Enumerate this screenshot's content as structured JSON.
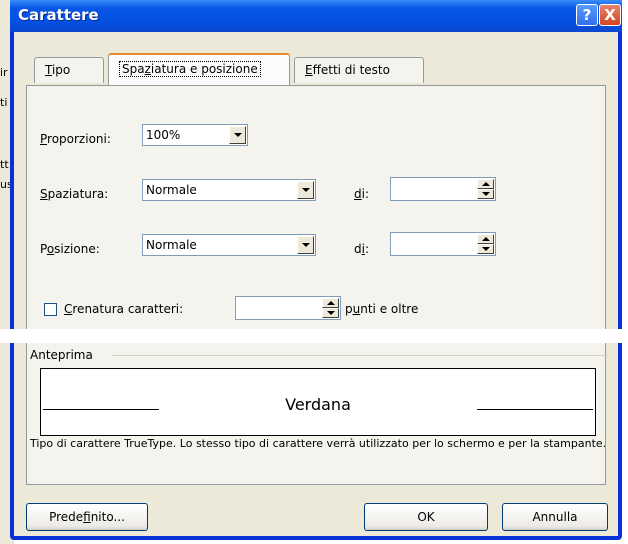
{
  "background_fragments": [
    "ir",
    "ti",
    "tt",
    "us"
  ],
  "window": {
    "title": "Carattere"
  },
  "titlebar_buttons": {
    "help": "?",
    "close": "X"
  },
  "tabs": [
    {
      "label_pre": "",
      "accel": "T",
      "label_post": "ipo"
    },
    {
      "label_pre": "Spa",
      "accel": "z",
      "label_post": "iatura e posizione"
    },
    {
      "label_pre": "",
      "accel": "E",
      "label_post": "ffetti di testo"
    }
  ],
  "proporzioni": {
    "label_pre": "",
    "accel": "P",
    "label_post": "roporzioni:",
    "value": "100%"
  },
  "spaziatura": {
    "label_pre": "",
    "accel": "S",
    "label_post": "paziatura:",
    "value": "Normale",
    "di_pre": "",
    "di_accel": "d",
    "di_post": "i:",
    "di_value": ""
  },
  "posizione": {
    "label_pre": "P",
    "accel": "o",
    "label_post": "sizione:",
    "value": "Normale",
    "di_pre": "d",
    "di_accel": "i",
    "di_post": ":",
    "di_value": ""
  },
  "crenatura": {
    "label_pre": "",
    "accel": "C",
    "label_post": "renatura caratteri:",
    "checked": false,
    "value": "",
    "unit_pre": "p",
    "unit_accel": "u",
    "unit_post": "nti e oltre"
  },
  "preview": {
    "group_label": "Anteprima",
    "sample_text": "Verdana",
    "description": "Tipo di carattere TrueType. Lo stesso tipo di carattere verrà utilizzato per lo schermo e per la stampante."
  },
  "buttons": {
    "default": {
      "pre": "Prede",
      "accel": "f",
      "post": "inito..."
    },
    "ok": "OK",
    "cancel": "Annulla"
  }
}
